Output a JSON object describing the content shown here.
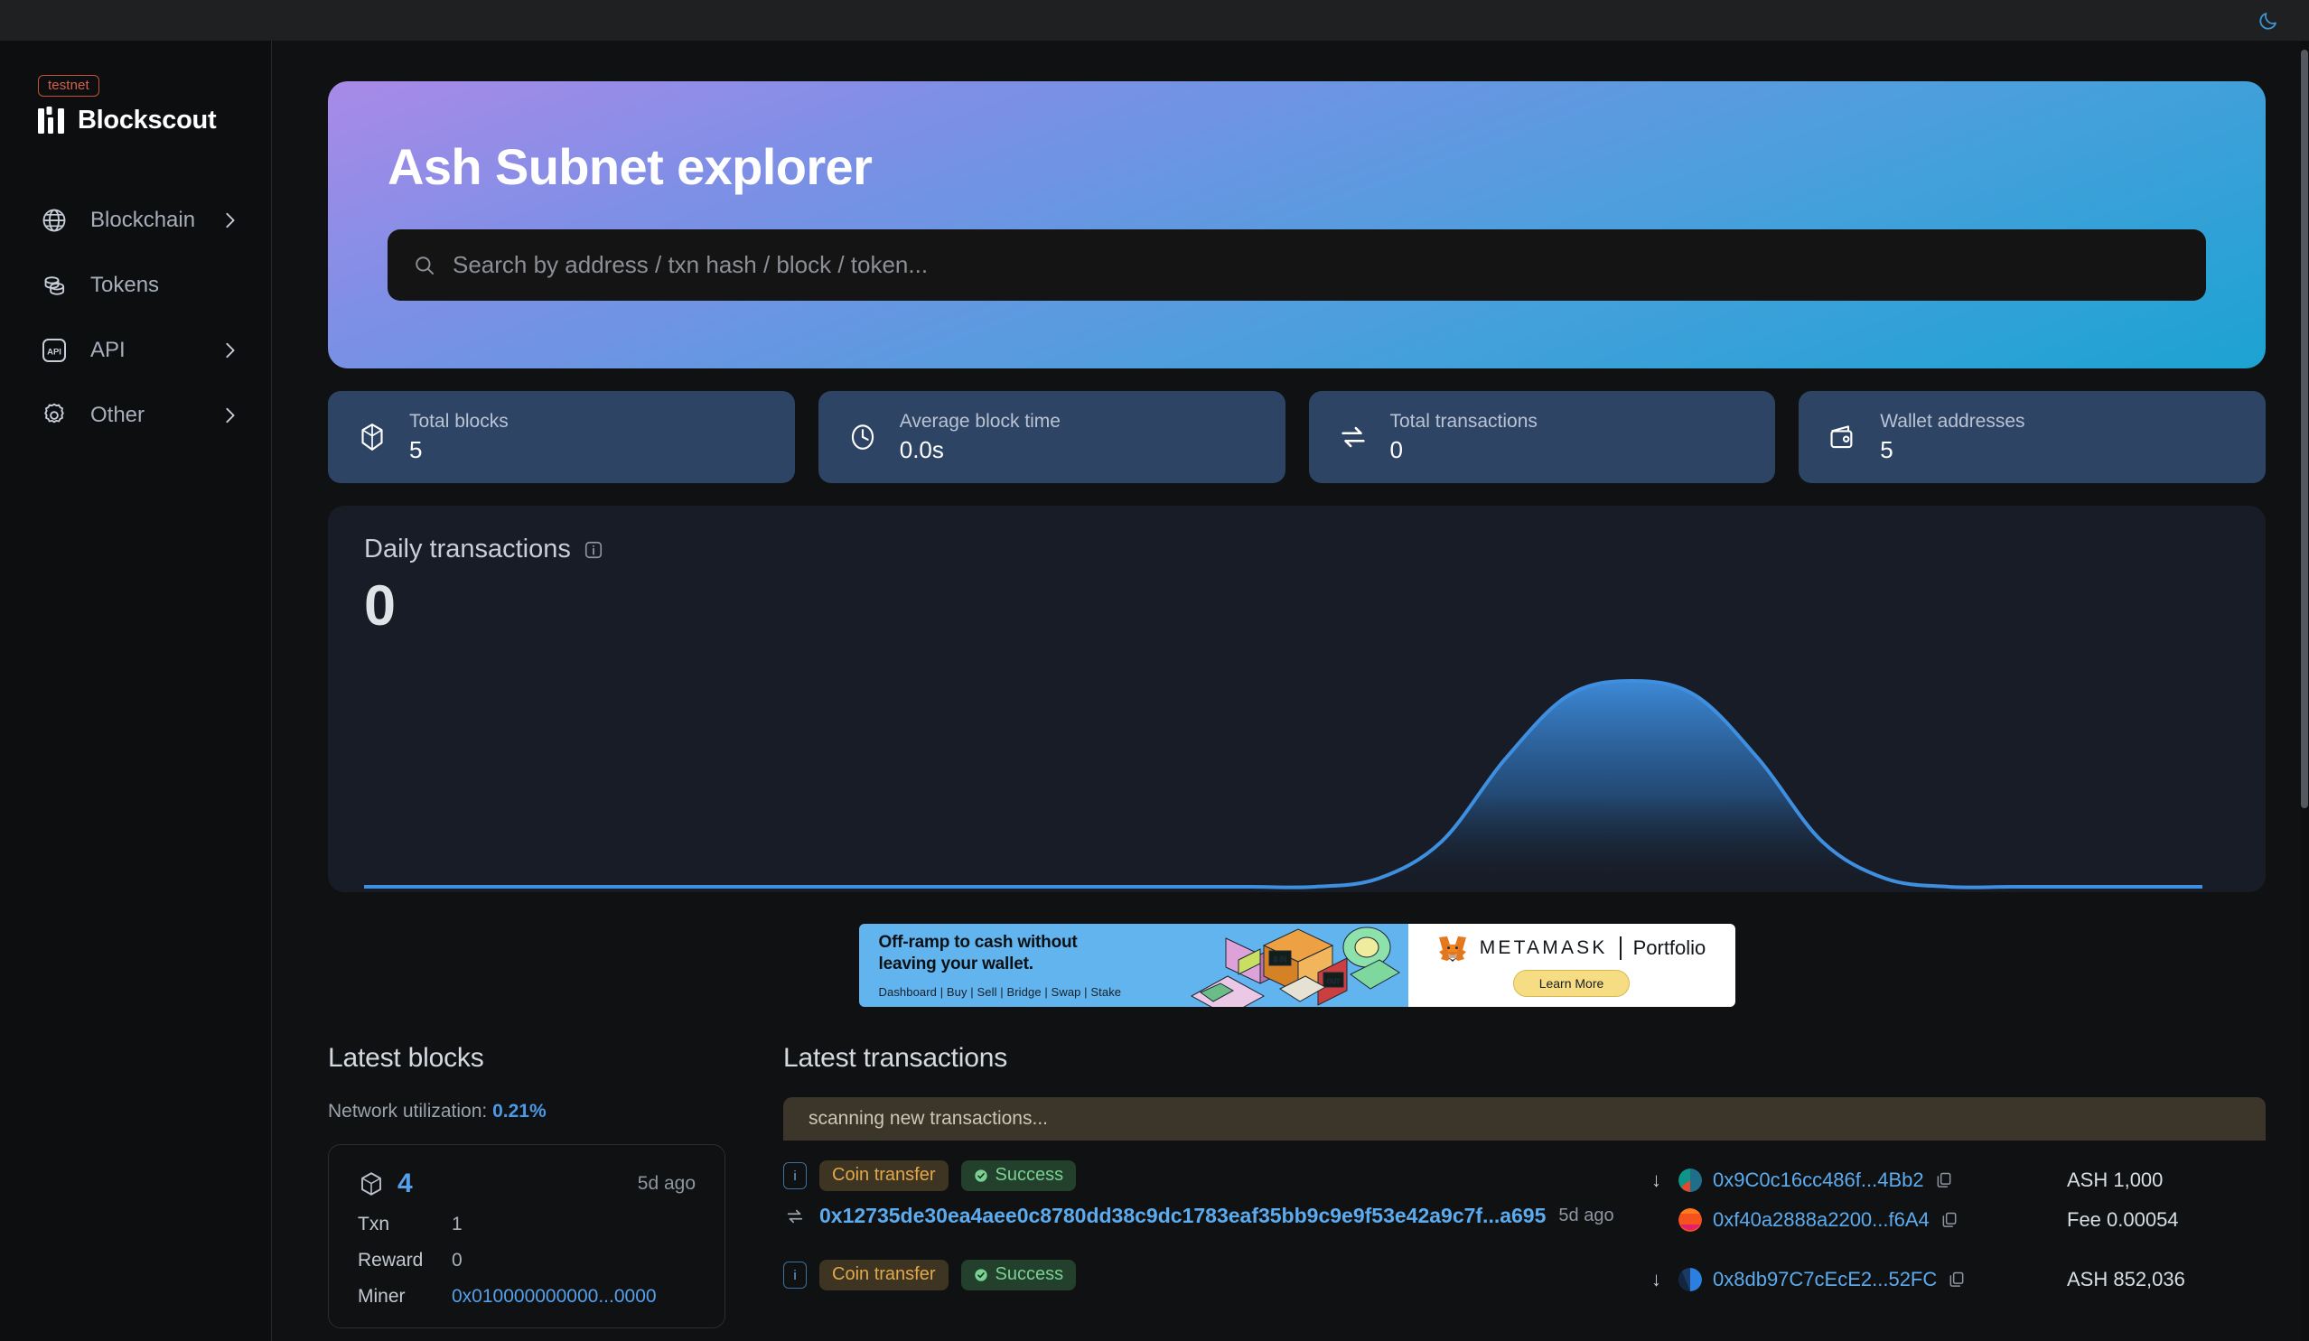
{
  "topbar": {
    "theme_toggle_icon": "moon-icon"
  },
  "sidebar": {
    "badge": "testnet",
    "brand": "Blockscout",
    "items": [
      {
        "label": "Blockchain",
        "icon": "globe-icon",
        "has_chevron": true
      },
      {
        "label": "Tokens",
        "icon": "coins-icon",
        "has_chevron": false
      },
      {
        "label": "API",
        "icon": "api-icon",
        "has_chevron": true
      },
      {
        "label": "Other",
        "icon": "gear-icon",
        "has_chevron": true
      }
    ]
  },
  "hero": {
    "title": "Ash Subnet explorer",
    "search_placeholder": "Search by address / txn hash / block / token...",
    "search_value": "",
    "search_icon": "search-icon",
    "gradient_from": "#a98ae8",
    "gradient_to": "#1ca3d2"
  },
  "stats": [
    {
      "label": "Total blocks",
      "value": "5",
      "icon": "block-icon"
    },
    {
      "label": "Average block time",
      "value": "0.0s",
      "icon": "clock-icon"
    },
    {
      "label": "Total transactions",
      "value": "0",
      "icon": "transfer-icon"
    },
    {
      "label": "Wallet addresses",
      "value": "5",
      "icon": "wallet-icon"
    }
  ],
  "chart": {
    "title": "Daily transactions",
    "info_icon": "info-icon",
    "value": "0"
  },
  "chart_data": {
    "type": "area",
    "title": "Daily transactions",
    "xlabel": "",
    "ylabel": "",
    "x": [
      0,
      1,
      2,
      3,
      4,
      5,
      6,
      7,
      8,
      9,
      10,
      11,
      12,
      13,
      14,
      15,
      16,
      17,
      18,
      19,
      20,
      21,
      22,
      23,
      24,
      25,
      26,
      27,
      28,
      29
    ],
    "values": [
      0,
      0,
      0,
      0,
      0,
      0,
      0,
      0,
      0,
      0,
      0,
      0,
      0,
      0,
      0,
      0,
      0.04,
      0.22,
      0.62,
      0.93,
      1.0,
      0.93,
      0.62,
      0.22,
      0.04,
      0,
      0,
      0,
      0,
      0
    ],
    "series": [
      {
        "name": "Daily transactions",
        "values": [
          0,
          0,
          0,
          0,
          0,
          0,
          0,
          0,
          0,
          0,
          0,
          0,
          0,
          0,
          0,
          0,
          0.04,
          0.22,
          0.62,
          0.93,
          1.0,
          0.93,
          0.62,
          0.22,
          0.04,
          0,
          0,
          0,
          0,
          0
        ]
      }
    ],
    "ylim": [
      0,
      1
    ],
    "grid": false,
    "legend": "none",
    "line_color": "#3f8fe0",
    "fill_from": "#3f8fe0",
    "fill_to": "#171c26"
  },
  "ad": {
    "headline_line1": "Off-ramp to cash without",
    "headline_line2": "leaving your wallet.",
    "links": "Dashboard  |  Buy  |  Sell  |  Bridge  |  Swap  |  Stake",
    "brand": "METAMASK",
    "product": "Portfolio",
    "cta": "Learn More",
    "fox_icon": "metamask-fox-icon"
  },
  "blocks": {
    "title": "Latest blocks",
    "network_utilization_label": "Network utilization:",
    "network_utilization_value": "0.21%",
    "items": [
      {
        "number": "4",
        "age": "5d ago",
        "txn_label": "Txn",
        "txn_value": "1",
        "reward_label": "Reward",
        "reward_value": "0",
        "miner_label": "Miner",
        "miner_value": "0x010000000000...0000"
      }
    ]
  },
  "transactions": {
    "title": "Latest transactions",
    "scanning_text": "scanning new transactions...",
    "items": [
      {
        "type_badge": "Coin transfer",
        "status_badge": "Success",
        "hash": "0x12735de30ea4aee0c8780dd38c9dc1783eaf35bb9c9e9f53e42a9c7f...a695",
        "age": "5d ago",
        "from": "0x9C0c16cc486f...4Bb2",
        "to": "0xf40a2888a2200...f6A4",
        "amount": "ASH 1,000",
        "fee": "Fee 0.00054"
      },
      {
        "type_badge": "Coin transfer",
        "status_badge": "Success",
        "hash": "",
        "age": "",
        "from": "0x8db97C7cEcE2...52FC",
        "to": "",
        "amount": "ASH 852,036",
        "fee": ""
      }
    ]
  }
}
